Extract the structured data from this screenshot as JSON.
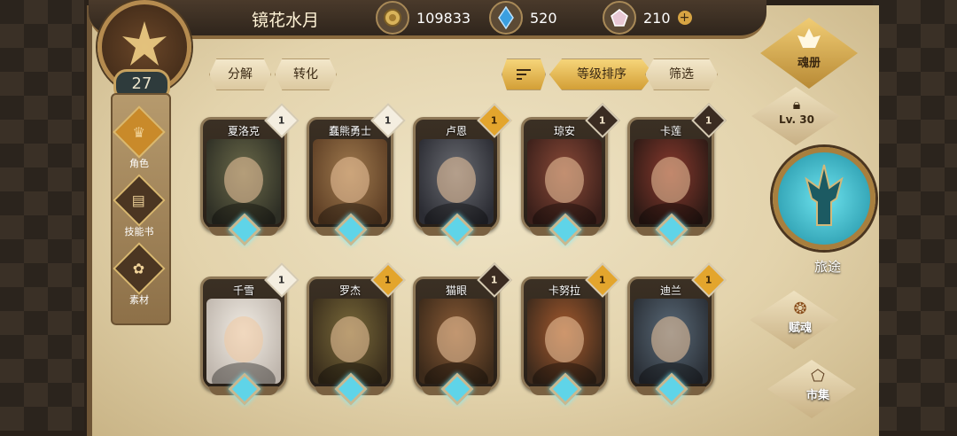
{
  "header": {
    "title": "镜花水月"
  },
  "resources": [
    {
      "name": "gold",
      "icon": "gold-coin-icon",
      "value": "109833"
    },
    {
      "name": "crystal",
      "icon": "blue-crystal-icon",
      "value": "520"
    },
    {
      "name": "gem",
      "icon": "pink-gem-icon",
      "value": "210"
    }
  ],
  "player": {
    "level": "27"
  },
  "left_menu": [
    {
      "label": "角色",
      "icon": "helmet-icon"
    },
    {
      "label": "技能书",
      "icon": "skill-book-icon"
    },
    {
      "label": "素材",
      "icon": "material-icon"
    }
  ],
  "filters": {
    "decompose": "分解",
    "convert": "转化",
    "sort_level": "等级排序",
    "filter": "筛选"
  },
  "characters": [
    {
      "name": "夏洛克",
      "level": "1",
      "rarity": "white",
      "colors": [
        "#6b6a4a",
        "#2e2f25"
      ]
    },
    {
      "name": "蠢熊勇士",
      "level": "1",
      "rarity": "white",
      "colors": [
        "#a07a4e",
        "#5e3f25"
      ]
    },
    {
      "name": "卢恩",
      "level": "1",
      "rarity": "gold",
      "colors": [
        "#6b6d73",
        "#2b2c33"
      ]
    },
    {
      "name": "琼安",
      "level": "1",
      "rarity": "dark",
      "colors": [
        "#8b4a38",
        "#3a1f1a"
      ]
    },
    {
      "name": "卡莲",
      "level": "1",
      "rarity": "dark",
      "colors": [
        "#8a3a2e",
        "#2d1a15"
      ]
    },
    {
      "name": "千雪",
      "level": "1",
      "rarity": "white",
      "colors": [
        "#f1ece4",
        "#bfb6ad"
      ]
    },
    {
      "name": "罗杰",
      "level": "1",
      "rarity": "gold",
      "colors": [
        "#7a6a3a",
        "#3a2e1c"
      ]
    },
    {
      "name": "猫眼",
      "level": "1",
      "rarity": "dark",
      "colors": [
        "#8a5b36",
        "#3c2a1a"
      ]
    },
    {
      "name": "卡努拉",
      "level": "1",
      "rarity": "gold",
      "colors": [
        "#a55a2e",
        "#3d2a1c"
      ]
    },
    {
      "name": "迪兰",
      "level": "1",
      "rarity": "gold",
      "colors": [
        "#5a6a78",
        "#2a2f36"
      ]
    }
  ],
  "right_menu": {
    "soul_book": "魂册",
    "locked_level": "Lv. 30",
    "journey": "旅途",
    "soul_gift": "赋魂",
    "market": "市集"
  }
}
